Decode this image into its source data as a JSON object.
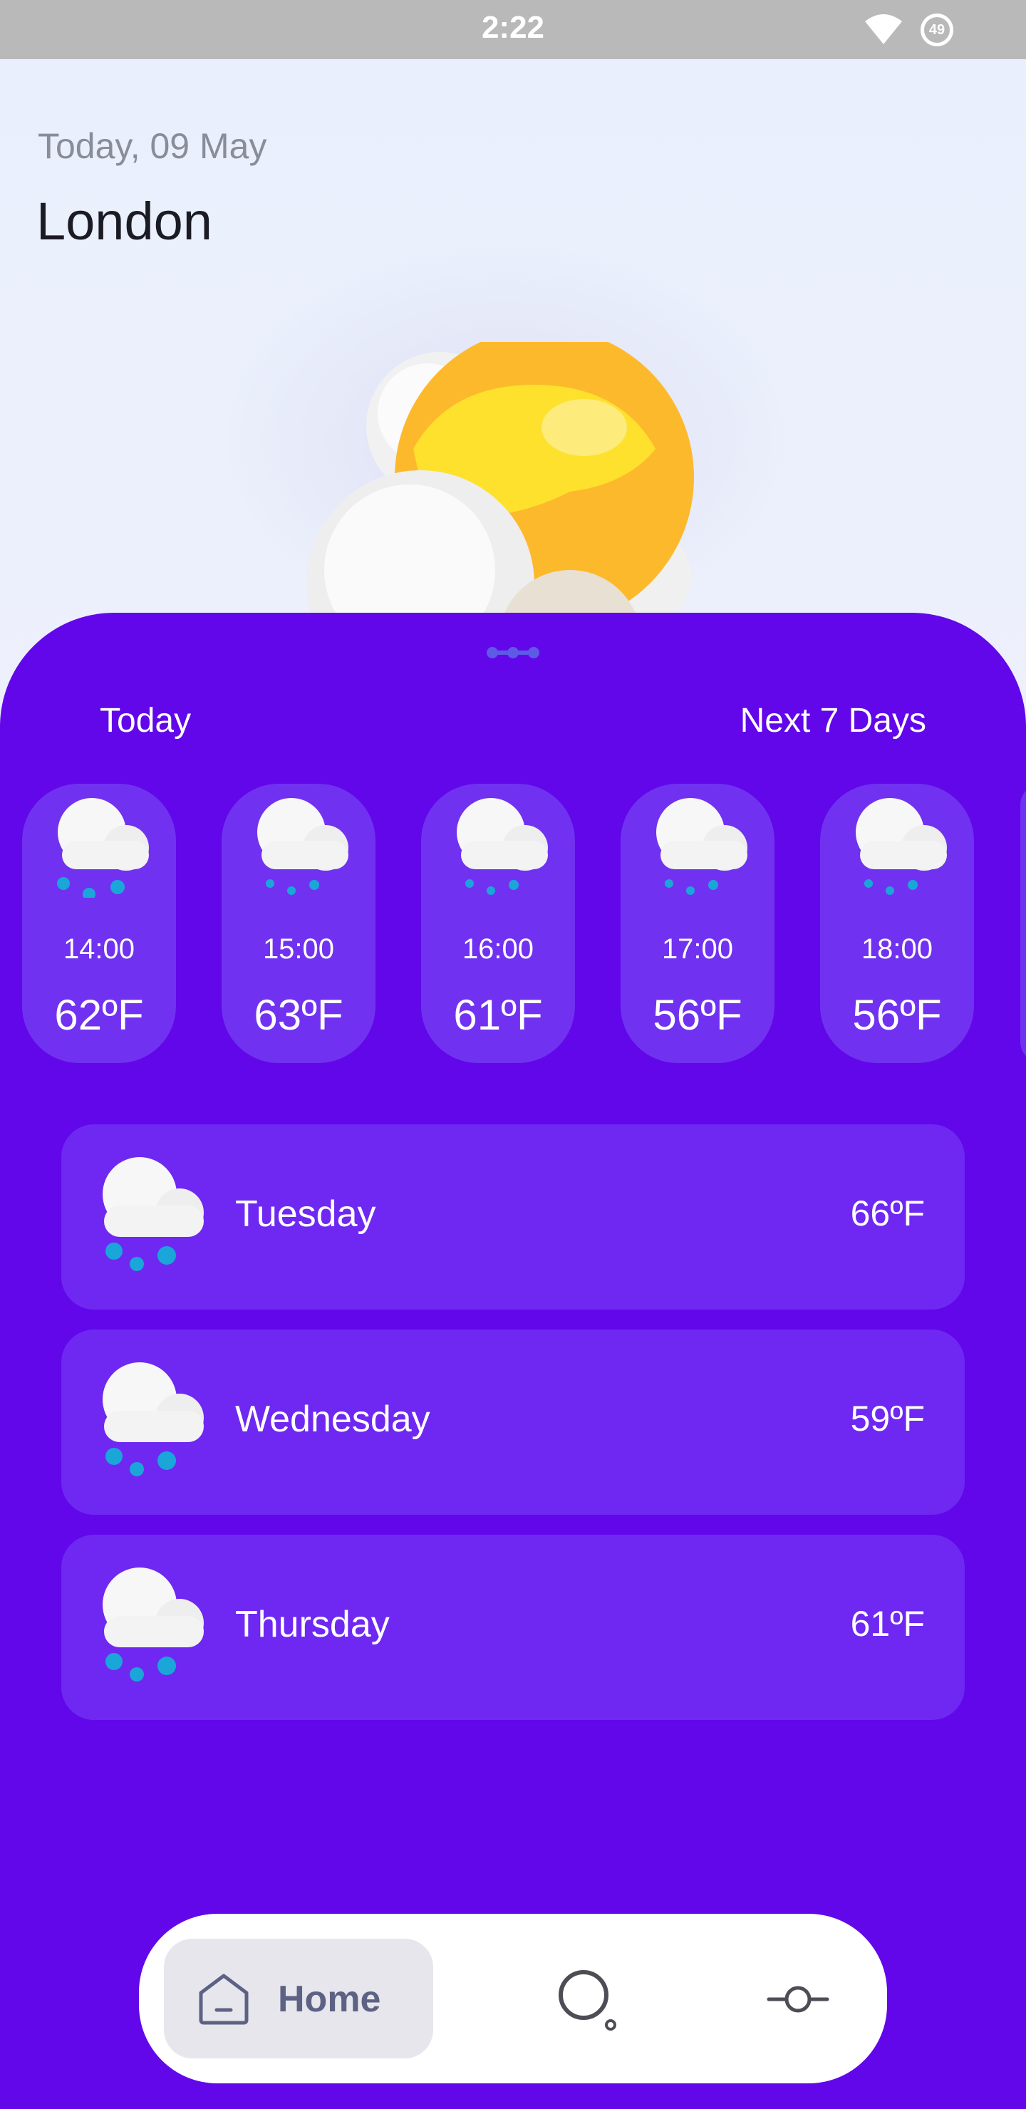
{
  "status_bar": {
    "time": "2:22",
    "battery": "49"
  },
  "header": {
    "date": "Today, 09 May",
    "city": "London"
  },
  "tabs": {
    "today": "Today",
    "next": "Next 7 Days"
  },
  "hourly": [
    {
      "time": "14:00",
      "temp": "62ºF",
      "icon": "rain-cloud-icon"
    },
    {
      "time": "15:00",
      "temp": "63ºF",
      "icon": "rain-cloud-icon"
    },
    {
      "time": "16:00",
      "temp": "61ºF",
      "icon": "rain-cloud-icon"
    },
    {
      "time": "17:00",
      "temp": "56ºF",
      "icon": "rain-cloud-icon"
    },
    {
      "time": "18:00",
      "temp": "56ºF",
      "icon": "rain-cloud-icon"
    }
  ],
  "daily": [
    {
      "day": "Tuesday",
      "temp": "66ºF",
      "icon": "rain-cloud-icon"
    },
    {
      "day": "Wednesday",
      "temp": "59ºF",
      "icon": "rain-cloud-icon"
    },
    {
      "day": "Thursday",
      "temp": "61ºF",
      "icon": "rain-cloud-icon"
    }
  ],
  "nav": {
    "home": "Home",
    "search_icon": "search-icon",
    "settings_icon": "slider-icon"
  },
  "colors": {
    "sheet": "#6207e9",
    "card": "#7032f0",
    "status_bar": "#b9b9b9"
  }
}
